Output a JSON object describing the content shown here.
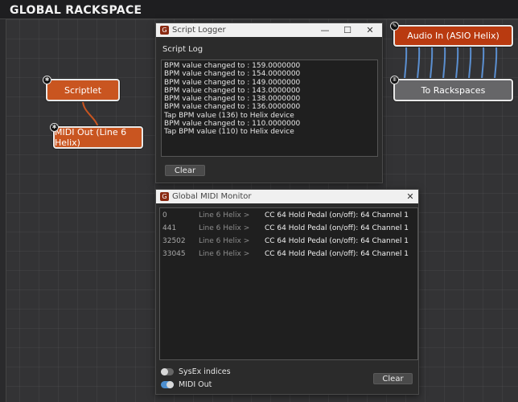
{
  "rackspace": {
    "title": "GLOBAL RACKSPACE"
  },
  "nodes": {
    "scriptlet": {
      "label": "Scriptlet"
    },
    "midi_out": {
      "label": "MIDI Out (Line 6 Helix)"
    },
    "audio_in": {
      "label": "Audio In (ASIO Helix)"
    },
    "to_rackspaces": {
      "label": "To Rackspaces"
    }
  },
  "script_logger": {
    "title": "Script Logger",
    "heading": "Script Log",
    "log_lines": [
      "BPM value changed to : 159.0000000",
      "BPM value changed to : 154.0000000",
      "BPM value changed to : 149.0000000",
      "BPM value changed to : 143.0000000",
      "BPM value changed to : 138.0000000",
      "BPM value changed to : 136.0000000",
      "Tap BPM value (136) to Helix device",
      "BPM value changed to : 110.0000000",
      "Tap BPM value (110) to Helix device"
    ],
    "clear_label": "Clear"
  },
  "midi_monitor": {
    "title": "Global MIDI Monitor",
    "rows": [
      {
        "time": "0",
        "device": "Line 6 Helix >",
        "message": "CC 64 Hold Pedal (on/off): 64 Channel 1"
      },
      {
        "time": "441",
        "device": "Line 6 Helix >",
        "message": "CC 64 Hold Pedal (on/off): 64 Channel 1"
      },
      {
        "time": "32502",
        "device": "Line 6 Helix >",
        "message": "CC 64 Hold Pedal (on/off): 64 Channel 1"
      },
      {
        "time": "33045",
        "device": "Line 6 Helix >",
        "message": "CC 64 Hold Pedal (on/off): 64 Channel 1"
      }
    ],
    "sysex_label": "SysEx indices",
    "sysex_on": false,
    "midi_out_label": "MIDI Out",
    "midi_out_on": true,
    "clear_label": "Clear"
  },
  "colors": {
    "node_orange": "#c95520",
    "node_red": "#b93a10",
    "node_gray": "#666668",
    "wire_blue": "#5b8fd0",
    "wire_orange": "#c95520",
    "toggle_on": "#4d8fd0"
  },
  "icons": {
    "node_pin": "gear-icon",
    "close": "close-icon",
    "minimize": "minimize-icon",
    "maximize": "maximize-icon",
    "app": "app-logo-icon"
  }
}
